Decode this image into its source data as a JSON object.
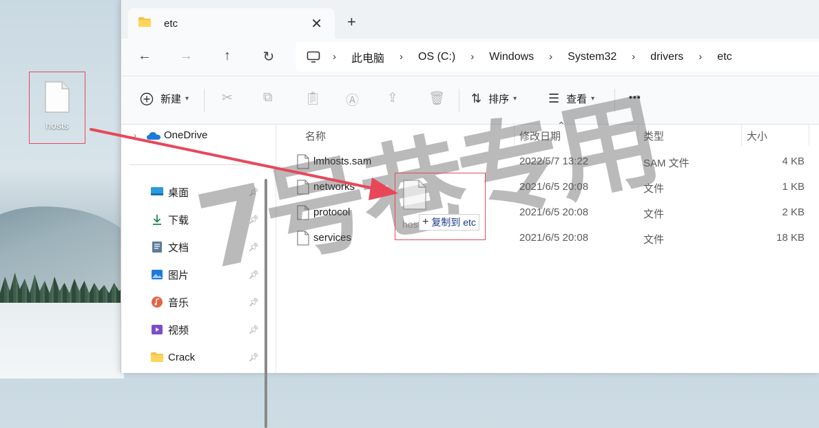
{
  "desktop": {
    "file_label": "hosts"
  },
  "window": {
    "tab": {
      "title": "etc",
      "close_glyph": "✕",
      "new_tab_glyph": "+"
    },
    "nav": {
      "back": "←",
      "forward": "→",
      "up": "↑",
      "refresh": "↻"
    },
    "breadcrumb": [
      "此电脑",
      "OS (C:)",
      "Windows",
      "System32",
      "drivers",
      "etc"
    ],
    "toolbar": {
      "new_label": "新建",
      "sort_label": "排序",
      "view_label": "查看",
      "more_label": "•••"
    },
    "navpane": {
      "onedrive": "OneDrive",
      "items": [
        {
          "label": "桌面",
          "icon": "desktop-icon"
        },
        {
          "label": "下载",
          "icon": "download-icon"
        },
        {
          "label": "文档",
          "icon": "document-icon"
        },
        {
          "label": "图片",
          "icon": "picture-icon"
        },
        {
          "label": "音乐",
          "icon": "music-icon"
        },
        {
          "label": "视频",
          "icon": "video-icon"
        },
        {
          "label": "Crack",
          "icon": "folder-icon"
        }
      ]
    },
    "filelist": {
      "headers": {
        "name": "名称",
        "modified": "修改日期",
        "type": "类型",
        "size": "大小"
      },
      "rows": [
        {
          "name": "lmhosts.sam",
          "modified": "2022/5/7 13:22",
          "type": "SAM 文件",
          "size": "4 KB"
        },
        {
          "name": "networks",
          "modified": "2021/6/5 20:08",
          "type": "文件",
          "size": "1 KB"
        },
        {
          "name": "protocol",
          "modified": "2021/6/5 20:08",
          "type": "文件",
          "size": "2 KB"
        },
        {
          "name": "services",
          "modified": "2021/6/5 20:08",
          "type": "文件",
          "size": "18 KB"
        }
      ]
    }
  },
  "drag": {
    "ghost_label": "hosts",
    "tooltip": "复制到 etc",
    "tooltip_glyph": "+"
  },
  "watermark": "7号巷专用",
  "colors": {
    "highlight_border": "#e8475a",
    "arrow": "#e8475a",
    "accent": "#1a5fb4"
  }
}
